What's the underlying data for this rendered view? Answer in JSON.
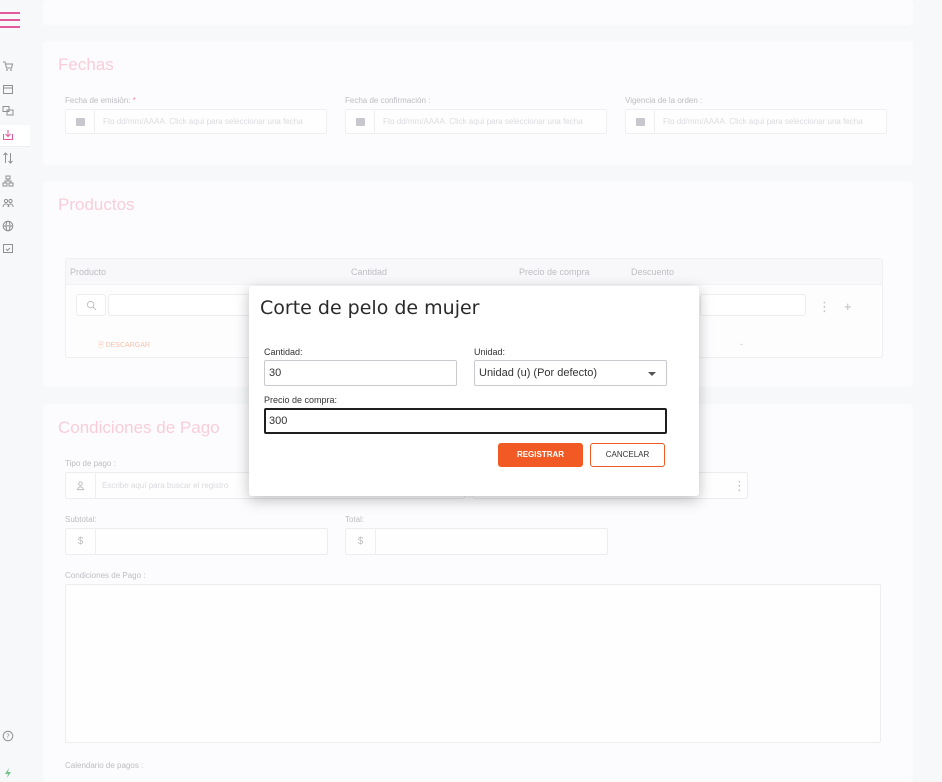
{
  "fechas": {
    "title": "Fechas",
    "emision_label": "Fecha de emisión:",
    "required_mark": "*",
    "confirmacion_label": "Fecha de confirmación :",
    "vigencia_label": "Vigencia de la orden :",
    "date_placeholder": "Fto dd/mm/AAAA. Click aquí para seleccionar una fecha"
  },
  "productos": {
    "title": "Productos",
    "columns": [
      "Producto",
      "Cantidad",
      "Precio de compra",
      "Descuento"
    ],
    "download_label": "DESCARGAR",
    "dash": "-"
  },
  "condiciones": {
    "title": "Condiciones de Pago",
    "tipo_pago_label": "Tipo de pago :",
    "tipo_pago_placeholder": "Escribe aquí para buscar el registro",
    "subtotal_label": "Subtotal:",
    "total_label": "Total:",
    "currency_symbol": "$",
    "condiciones_label": "Condiciones de Pago :",
    "calendario_label": "Calendario de pagos :"
  },
  "modal": {
    "title": "Corte de pelo de mujer",
    "cantidad_label": "Cantidad:",
    "cantidad_value": "30",
    "unidad_label": "Unidad:",
    "unidad_value": "Unidad (u) (Por defecto)",
    "precio_label": "Precio de compra:",
    "precio_value": "300",
    "register_label": "REGISTRAR",
    "cancel_label": "CANCELAR"
  },
  "sidebar": {
    "icons": [
      "menu-icon",
      "cart-icon",
      "calendar-icon",
      "chat-icon",
      "download-icon",
      "sort-icon",
      "org-icon",
      "users-icon",
      "globe-icon",
      "calendar-check-icon",
      "help-icon",
      "bolt-icon"
    ]
  },
  "colors": {
    "brand": "#d6006b",
    "accent": "#f15a24",
    "section_title": "#f6b3c3"
  }
}
